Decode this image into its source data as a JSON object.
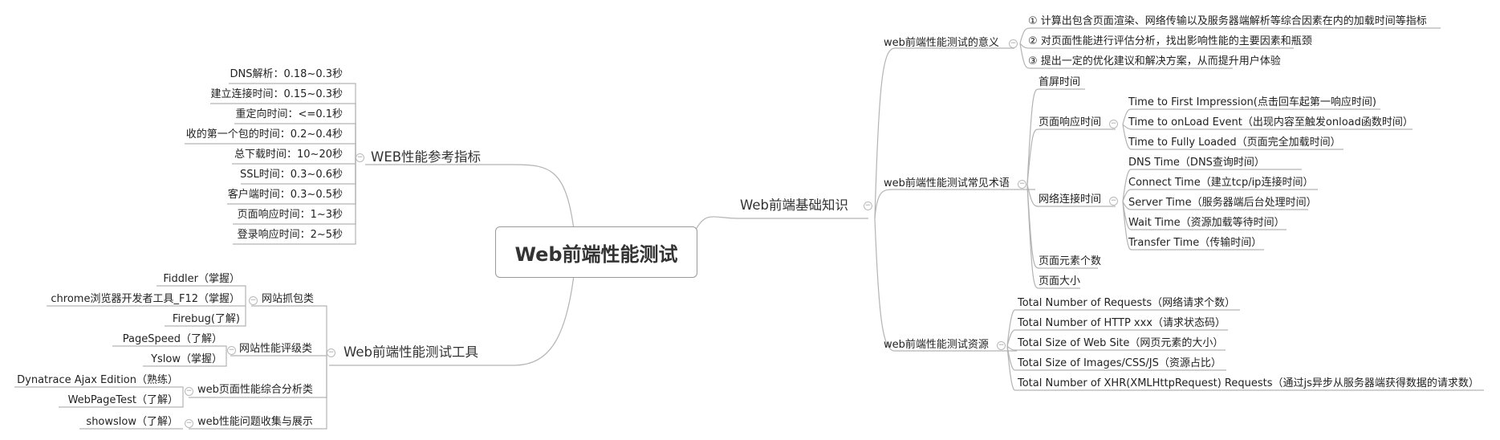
{
  "root": {
    "title": "Web前端性能测试"
  },
  "branches": {
    "basics": {
      "label": "Web前端基础知识",
      "meaning": {
        "label": "web前端性能测试的意义",
        "items": [
          "① 计算出包含页面渲染、网络传输以及服务器端解析等综合因素在内的加载时间等指标",
          "② 对页面性能进行评估分析，找出影响性能的主要因素和瓶颈",
          "③ 提出一定的优化建议和解决方案，从而提升用户体验"
        ]
      },
      "terms": {
        "label": "web前端性能测试常见术语",
        "first_screen": "首屏时间",
        "page_response": {
          "label": "页面响应时间",
          "items": [
            "Time to First Impression(点击回车起第一响应时间)",
            "Time to onLoad Event（出现内容至触发onload函数时间）",
            "Time to Fully Loaded（页面完全加载时间）"
          ]
        },
        "network": {
          "label": "网络连接时间",
          "items": [
            "DNS Time（DNS查询时间）",
            "Connect Time（建立tcp/ip连接时间）",
            "Server Time（服务器端后台处理时间）",
            "Wait Time（资源加载等待时间）",
            "Transfer Time（传输时间）"
          ]
        },
        "element_count": "页面元素个数",
        "page_size": "页面大小"
      },
      "resources": {
        "label": "web前端性能测试资源",
        "items": [
          "Total Number of Requests（网络请求个数）",
          "Total Number of HTTP xxx（请求状态码）",
          "Total Size of Web Site（网页元素的大小）",
          "Total Size of Images/CSS/JS（资源占比）",
          "Total Number of XHR(XMLHttpRequest) Requests（通过js异步从服务器端获得数据的请求数）"
        ]
      }
    },
    "metrics": {
      "label": "WEB性能参考指标",
      "items": [
        "DNS解析：0.18~0.3秒",
        "建立连接时间：0.15~0.3秒",
        "重定向时间：<=0.1秒",
        "收的第一个包的时间：0.2~0.4秒",
        "总下载时间：10~20秒",
        "SSL时间：0.3~0.6秒",
        "客户端时间：0.3~0.5秒",
        "页面响应时间：1~3秒",
        "登录响应时间：2~5秒"
      ]
    },
    "tools": {
      "label": "Web前端性能测试工具",
      "capture": {
        "label": "网站抓包类",
        "items": [
          "Fiddler（掌握）",
          "chrome浏览器开发者工具_F12（掌握）",
          "Firebug(了解)"
        ]
      },
      "rating": {
        "label": "网站性能评级类",
        "items": [
          "PageSpeed（了解）",
          "Yslow（掌握）"
        ]
      },
      "analysis": {
        "label": "web页面性能综合分析类",
        "items": [
          "Dynatrace Ajax Edition（熟练）",
          "WebPageTest（了解）"
        ]
      },
      "collect": {
        "label": "web性能问题收集与展示",
        "items": [
          "showslow（了解）"
        ]
      }
    }
  }
}
